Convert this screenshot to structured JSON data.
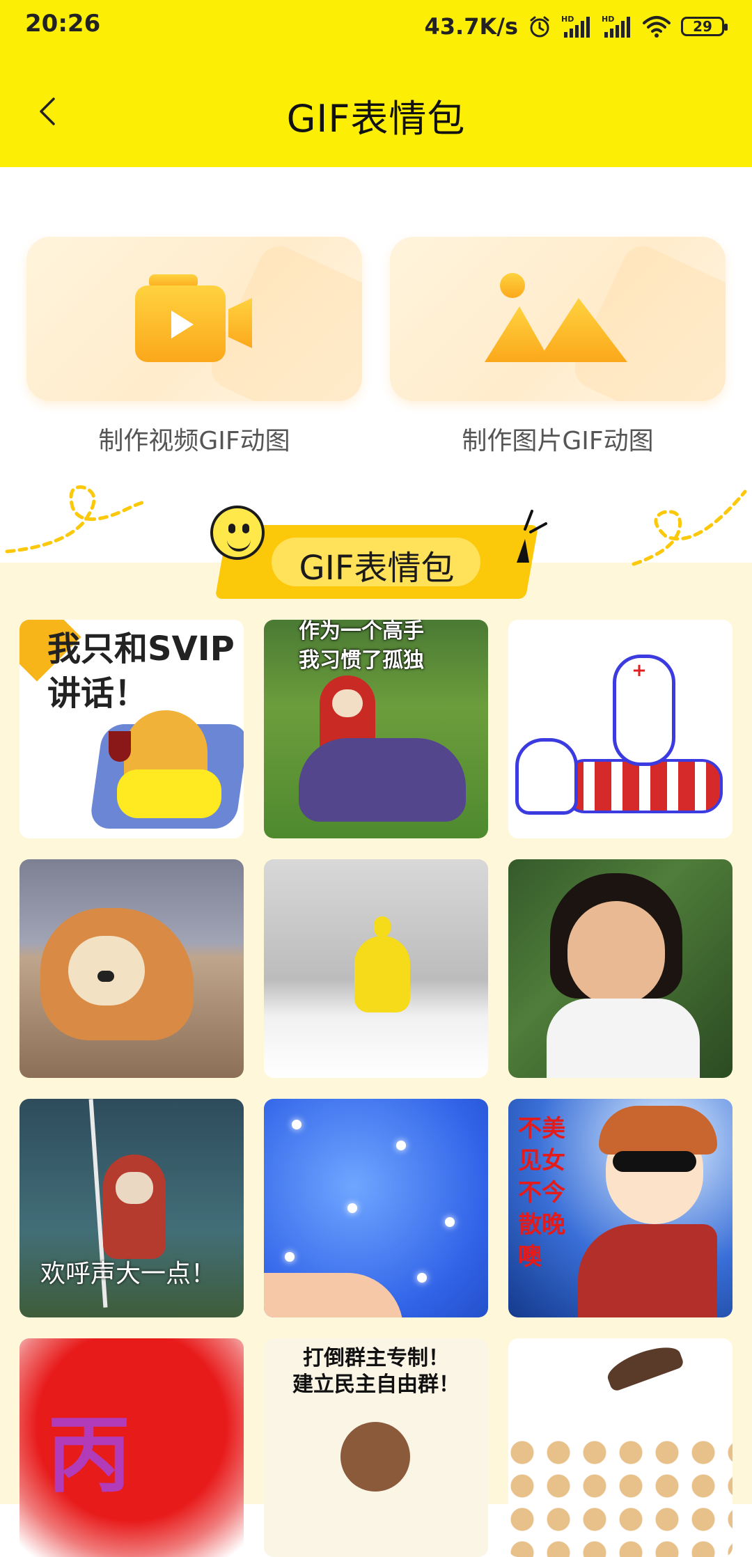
{
  "status_bar": {
    "time": "20:26",
    "net_speed": "43.7K/s",
    "battery": "29",
    "icons": [
      "alarm-icon",
      "hd-signal-icon",
      "hd-signal-icon",
      "wifi-icon",
      "battery-icon"
    ]
  },
  "header": {
    "title": "GIF表情包",
    "back_icon": "back-arrow-icon",
    "background": "#FDEE05"
  },
  "make_options": [
    {
      "label": "制作视频GIF动图",
      "icon": "video-camera-icon"
    },
    {
      "label": "制作图片GIF动图",
      "icon": "image-mountain-icon"
    }
  ],
  "section": {
    "title": "GIF表情包",
    "icon": "smiley-icon",
    "accent": "#FBC80A"
  },
  "gifs": [
    {
      "caption": "我只和SVIP\n讲话！"
    },
    {
      "caption": "作为一个高手\n我习惯了孤独"
    },
    {
      "caption": ""
    },
    {
      "caption": ""
    },
    {
      "caption": ""
    },
    {
      "caption": ""
    },
    {
      "caption": "欢呼声大一点！"
    },
    {
      "caption": ""
    },
    {
      "caption": "不美见女不今散晚噢"
    },
    {
      "caption": "丙"
    },
    {
      "caption": "打倒群主专制！\n建立民主自由群！"
    },
    {
      "caption": ""
    }
  ]
}
